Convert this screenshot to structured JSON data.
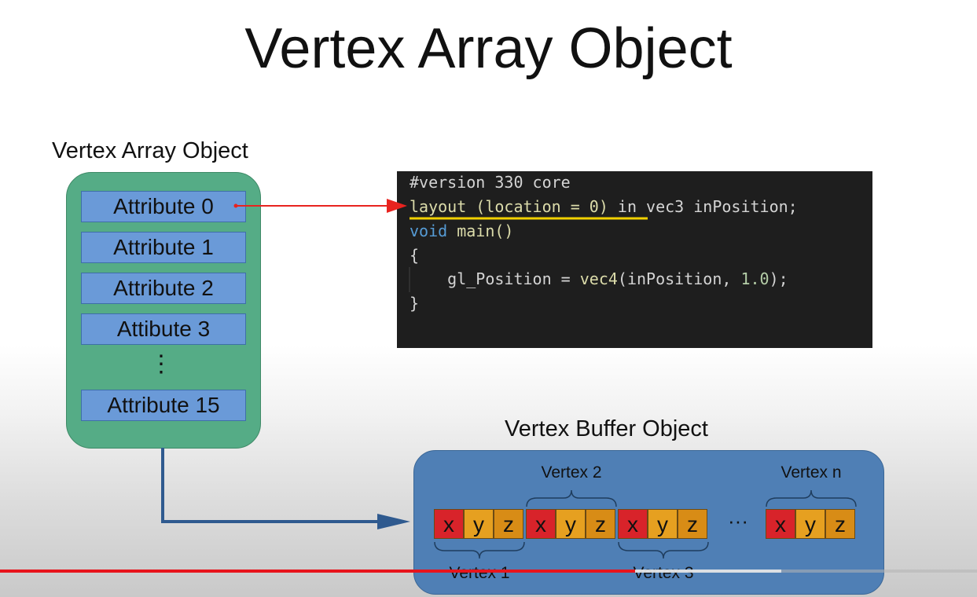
{
  "title": "Vertex Array Object",
  "vao": {
    "label": "Vertex Array Object",
    "attributes": [
      "Attribute 0",
      "Attribute 1",
      "Attribute 2",
      "Attibute 3",
      "Attribute 15"
    ],
    "ellipsis": "⋮"
  },
  "code": {
    "line1": "#version 330 core",
    "line2_underlined": "layout (location = 0)",
    "line2_rest": " in vec3 inPosition;",
    "line3_kw": "void",
    "line3_rest": " main()",
    "line4": "{",
    "line5_a": "    gl_Position = ",
    "line5_fn": "vec4",
    "line5_b": "(inPosition, ",
    "line5_num": "1.0",
    "line5_c": ");",
    "line6": "}"
  },
  "vbo": {
    "label": "Vertex Buffer Object",
    "components": [
      "x",
      "y",
      "z"
    ],
    "ellipsis": "···",
    "vertex_labels": {
      "v1": "Vertex 1",
      "v2": "Vertex 2",
      "v3": "Vertex 3",
      "vn": "Vertex n"
    }
  },
  "video": {
    "played_fraction": 0.65,
    "buffered_fraction": 0.8
  },
  "colors": {
    "vao_fill": "#55ac86",
    "vbo_fill": "#4f7fb5",
    "attr_fill": "#6a9ad8",
    "x_color": "#d8232a",
    "y_color": "#e6a020",
    "z_color": "#d88c16",
    "arrow_red": "#e8231f",
    "arrow_blue": "#2f5a8f",
    "underline_yellow": "#f2d100"
  }
}
